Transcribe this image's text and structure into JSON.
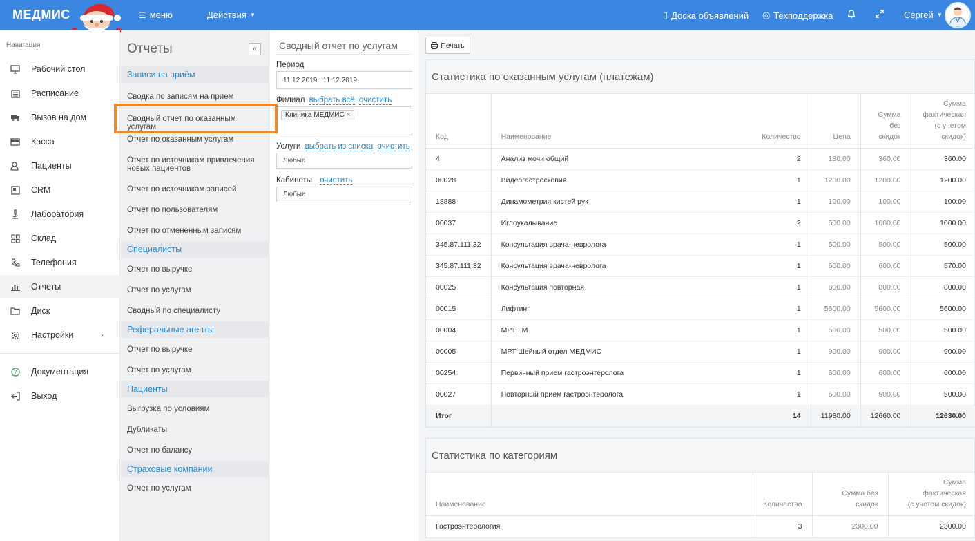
{
  "header": {
    "logo": "МЕДМИС",
    "menu_label": "меню",
    "actions_label": "Действия",
    "board_label": "Доска объявлений",
    "support_label": "Техподдержка",
    "user_label": "Сергей"
  },
  "nav": {
    "caption": "Навигация",
    "items": [
      {
        "label": "Рабочий стол",
        "icon": "monitor-icon"
      },
      {
        "label": "Расписание",
        "icon": "calendar-icon"
      },
      {
        "label": "Вызов на дом",
        "icon": "truck-icon"
      },
      {
        "label": "Касса",
        "icon": "credit-card-icon"
      },
      {
        "label": "Пациенты",
        "icon": "users-icon"
      },
      {
        "label": "CRM",
        "icon": "crm-icon"
      },
      {
        "label": "Лаборатория",
        "icon": "microscope-icon"
      },
      {
        "label": "Склад",
        "icon": "grid-icon"
      },
      {
        "label": "Телефония",
        "icon": "phone-icon"
      },
      {
        "label": "Отчеты",
        "icon": "bar-chart-icon"
      },
      {
        "label": "Диск",
        "icon": "folder-icon"
      },
      {
        "label": "Настройки",
        "icon": "gear-icon"
      }
    ],
    "docs_label": "Документация",
    "logout_label": "Выход"
  },
  "reports": {
    "title": "Отчеты",
    "collapse": "«",
    "groups": {
      "appointments": "Записи на приём",
      "specialists": "Специалисты",
      "referral": "Реферальные агенты",
      "patients": "Пациенты",
      "insurance": "Страховые компании"
    },
    "items": {
      "a1": "Сводка по записям на прием",
      "a2": "Сводный отчет по оказанным услугам",
      "a3": "Отчет по оказанным услугам",
      "a4": "Отчет по источникам привлечения новых пациентов",
      "a5": "Отчет по источникам записей",
      "a6": "Отчет по пользователям",
      "a7": "Отчет по отмененным записям",
      "s1": "Отчет по выручке",
      "s2": "Отчет по услугам",
      "s3": "Сводный по специалисту",
      "r1": "Отчет по выручке",
      "r2": "Отчет по услугам",
      "p1": "Выгрузка по условиям",
      "p2": "Дубликаты",
      "p3": "Отчет по балансу",
      "i1": "Отчет по услугам"
    }
  },
  "filters": {
    "title": "Сводный отчет по услугам",
    "period_label": "Период",
    "period_value": "11.12.2019 : 11.12.2019",
    "branch_label": "Филиал",
    "select_all": "выбрать всё",
    "clear": "очистить",
    "branch_tag": "Клиника МЕДМИС",
    "services_label": "Услуги",
    "select_from_list": "выбрать из списка",
    "services_value": "Любые",
    "cabinets_label": "Кабинеты",
    "cabinets_value": "Любые"
  },
  "main": {
    "print_label": "Печать",
    "services_panel": {
      "title": "Статистика по оказанным услугам (платежам)",
      "headers": {
        "code": "Код",
        "name": "Наименование",
        "qty": "Количество",
        "price": "Цена",
        "sum_nodisc_1": "Сумма",
        "sum_nodisc_2": "без",
        "sum_nodisc_3": "скидок",
        "sum_fact_1": "Сумма",
        "sum_fact_2": "фактическая",
        "sum_fact_3": "(с учетом",
        "sum_fact_4": "скидок)"
      },
      "rows": [
        {
          "code": "4",
          "name": "Анализ мочи общий",
          "qty": "2",
          "price": "180.00",
          "sum": "360.00",
          "fact": "360.00"
        },
        {
          "code": "00028",
          "name": "Видеогастроскопия",
          "qty": "1",
          "price": "1200.00",
          "sum": "1200.00",
          "fact": "1200.00"
        },
        {
          "code": "18888",
          "name": "Динамометрия кистей рук",
          "qty": "1",
          "price": "100.00",
          "sum": "100.00",
          "fact": "100.00"
        },
        {
          "code": "00037",
          "name": "Иглоукалывание",
          "qty": "2",
          "price": "500.00",
          "sum": "1000.00",
          "fact": "1000.00"
        },
        {
          "code": "345.87.111.32",
          "name": "Консультация врача-невролога",
          "qty": "1",
          "price": "500.00",
          "sum": "500.00",
          "fact": "500.00"
        },
        {
          "code": "345.87.111.32",
          "name": "Консультация врача-невролога",
          "qty": "1",
          "price": "600.00",
          "sum": "600.00",
          "fact": "570.00"
        },
        {
          "code": "00025",
          "name": "Консультация повторная",
          "qty": "1",
          "price": "800.00",
          "sum": "800.00",
          "fact": "800.00"
        },
        {
          "code": "00015",
          "name": "Лифтинг",
          "qty": "1",
          "price": "5600.00",
          "sum": "5600.00",
          "fact": "5600.00"
        },
        {
          "code": "00004",
          "name": "МРТ ГМ",
          "qty": "1",
          "price": "500.00",
          "sum": "500.00",
          "fact": "500.00"
        },
        {
          "code": "00005",
          "name": "МРТ Шейный отдел МЕДМИС",
          "qty": "1",
          "price": "900.00",
          "sum": "900.00",
          "fact": "900.00"
        },
        {
          "code": "00254",
          "name": "Первичный прием гастроэнтеролога",
          "qty": "1",
          "price": "600.00",
          "sum": "600.00",
          "fact": "600.00"
        },
        {
          "code": "00027",
          "name": "Повторный прием гастроэнтеролога",
          "qty": "1",
          "price": "500.00",
          "sum": "500.00",
          "fact": "500.00"
        }
      ],
      "total": {
        "label": "Итог",
        "qty": "14",
        "price": "11980.00",
        "sum": "12660.00",
        "fact": "12630.00"
      }
    },
    "categories_panel": {
      "title": "Статистика по категориям",
      "headers": {
        "name": "Наименование",
        "qty": "Количество",
        "sum_nodisc_1": "Сумма без",
        "sum_nodisc_2": "скидок",
        "sum_fact_1": "Сумма",
        "sum_fact_2": "фактическая",
        "sum_fact_3": "(с учетом скидок)"
      },
      "rows": [
        {
          "name": "Гастроэнтерология",
          "qty": "3",
          "sum": "2300.00",
          "fact": "2300.00"
        }
      ]
    }
  }
}
